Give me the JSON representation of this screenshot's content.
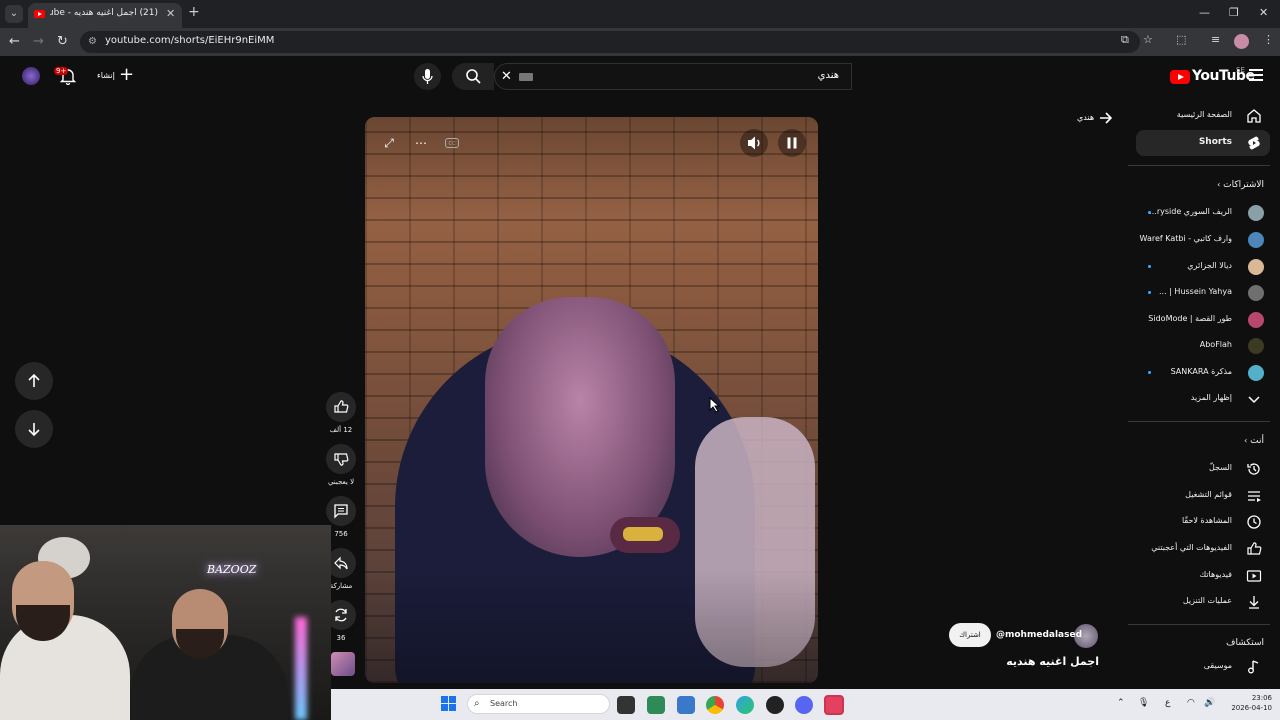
{
  "browser": {
    "tab_title": "(21) اجمل اغنيه هنديه - YouTube",
    "url": "youtube.com/shorts/EiEHr9nEiMM",
    "colors": {
      "tabbar": "#202124",
      "toolbar": "#35363a"
    }
  },
  "header": {
    "logo_text": "YouTube",
    "country_code": "SE",
    "search_query": "هندي",
    "create_label": "إنشاء",
    "notifications_badge": "9+"
  },
  "sidebar": {
    "home": "الصفحة الرئيسية",
    "shorts": "Shorts",
    "subscriptions_heading": "الاشتراكات",
    "subscriptions": [
      {
        "label": "الريف السوري ryside...",
        "new": true
      },
      {
        "label": "وارف كاتبي - Waref Katbi",
        "new": false
      },
      {
        "label": "ديالا الجزائري",
        "new": true
      },
      {
        "label": "Hussein Yahya | ...",
        "new": true
      },
      {
        "label": "طور القصة | SidoMode",
        "new": false
      },
      {
        "label": "AboFlah",
        "new": false
      },
      {
        "label": "مذكرة SANKARA",
        "new": true
      }
    ],
    "show_more": "إظهار المزيد",
    "you_heading": "أنت",
    "you_items": [
      {
        "label": "السجلّ",
        "icon": "history-icon"
      },
      {
        "label": "قوائم التشغيل",
        "icon": "playlist-icon"
      },
      {
        "label": "المشاهدة لاحقًا",
        "icon": "watch-later-icon"
      },
      {
        "label": "الفيديوهات التي أعجبتني",
        "icon": "like-icon"
      },
      {
        "label": "فيديوهاتك",
        "icon": "your-videos-icon"
      },
      {
        "label": "عمليات التنزيل",
        "icon": "download-icon"
      }
    ],
    "explore_heading": "استكشاف",
    "explore_items": [
      {
        "label": "موسيقى",
        "icon": "music-icon"
      }
    ]
  },
  "player": {
    "back_label": "هندي",
    "likes": "12 ألف",
    "dislike_label": "لا يعجبني",
    "comments": "756",
    "share_label": "مشاركة",
    "remix_count": "36",
    "channel_handle": "@mohmedalased",
    "subscribe_label": "اشتراك",
    "short_title": "اجمل اغنيه هنديه"
  },
  "webcam": {
    "neon_text": "BAZOOZ"
  },
  "taskbar": {
    "search_label": "Search",
    "time": "23:06",
    "date": "2026-04-10",
    "lang": "ع"
  }
}
